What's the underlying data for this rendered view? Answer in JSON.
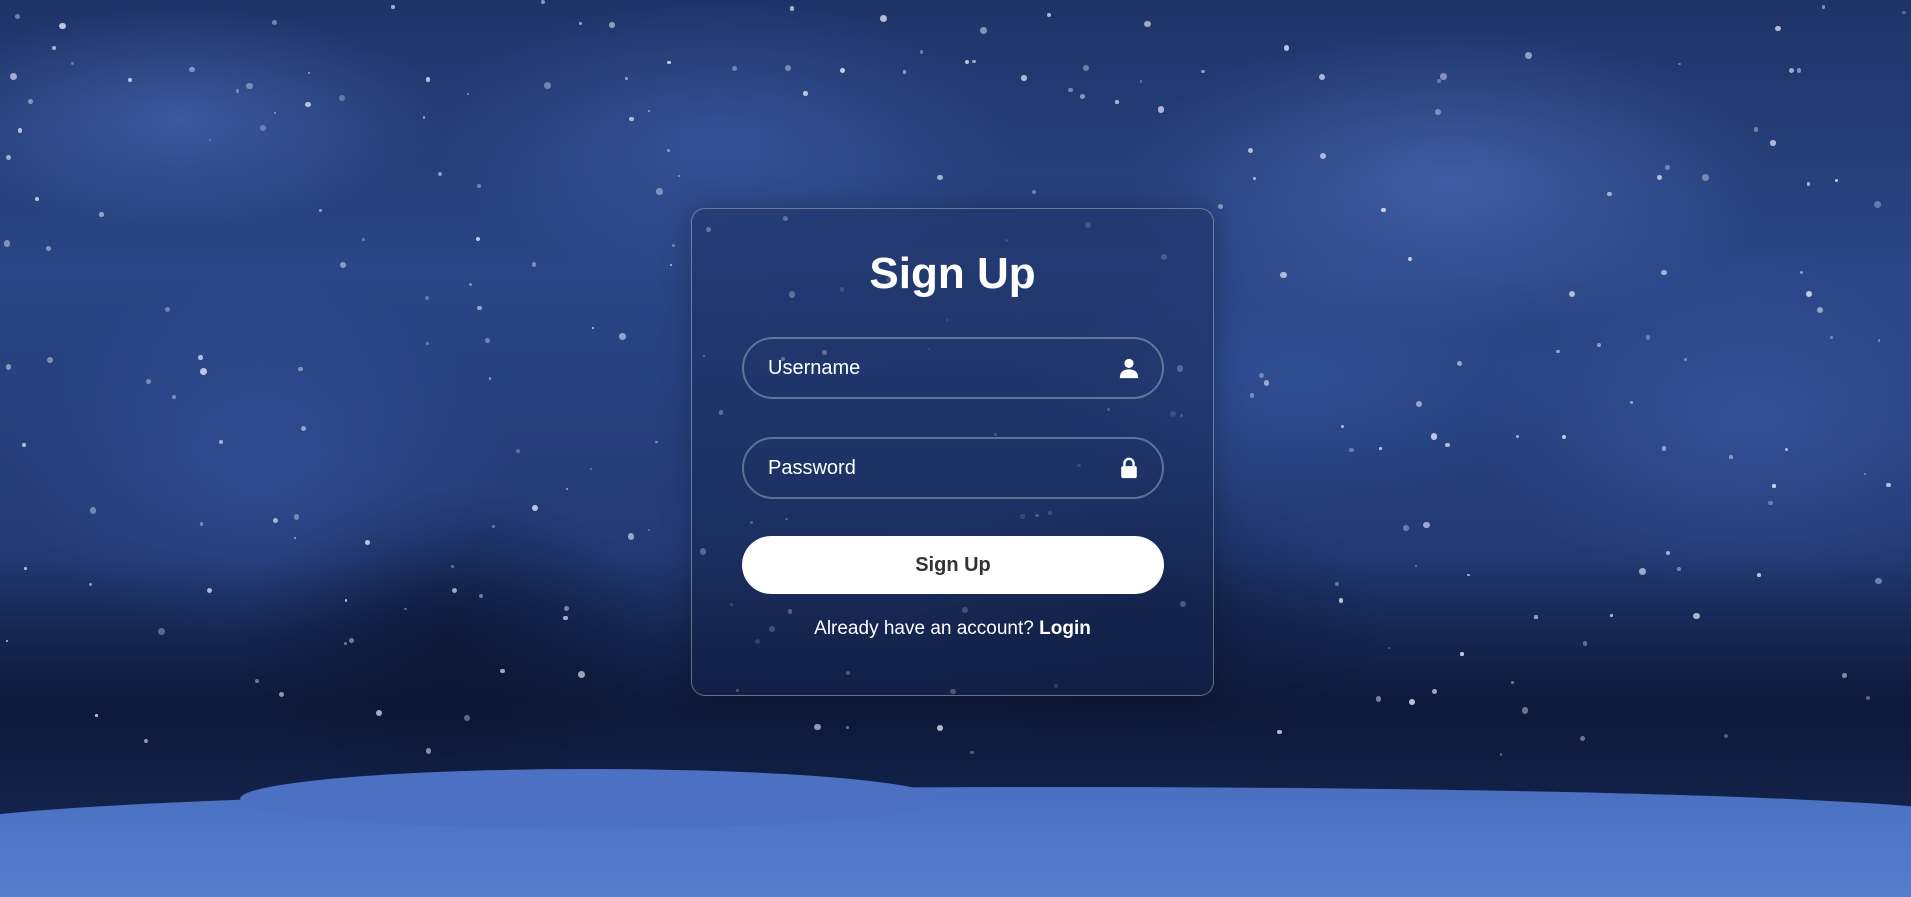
{
  "form": {
    "title": "Sign Up",
    "username": {
      "placeholder": "Username",
      "value": "",
      "icon": "user-icon"
    },
    "password": {
      "placeholder": "Password",
      "value": "",
      "icon": "lock-icon"
    },
    "submit_label": "Sign Up",
    "footer_prompt": "Already have an account?",
    "login_link_label": "Login"
  },
  "colors": {
    "button_bg": "#ffffff",
    "button_text": "#333333",
    "text": "#ffffff"
  }
}
